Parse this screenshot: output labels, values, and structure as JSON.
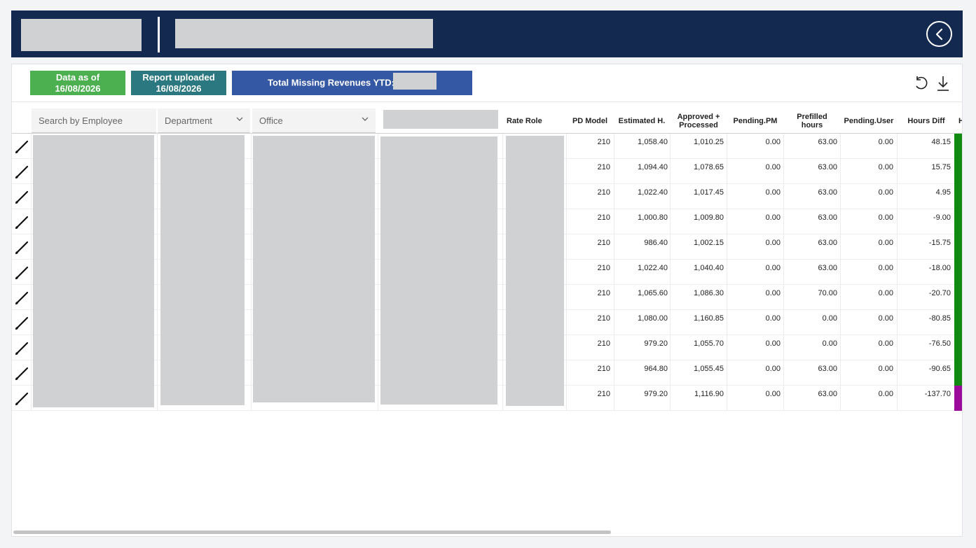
{
  "header": {
    "back_icon": "chevron-left-circle-icon"
  },
  "badges": {
    "data_as_of_label": "Data as of",
    "data_as_of_date": "16/08/2026",
    "report_uploaded_label": "Report uploaded",
    "report_uploaded_date": "16/08/2026",
    "total_missing_label": "Total Missing Revenues YTD:"
  },
  "toolbar": {
    "undo_icon": "undo-icon",
    "download_icon": "download-icon"
  },
  "filters": {
    "employee_placeholder": "Search by Employee",
    "department": "Department",
    "office": "Office"
  },
  "columns": {
    "rate_role": "Rate Role",
    "pd_model": "PD Model",
    "estimated": "Estimated H.",
    "approved_line1": "Approved +",
    "approved_line2": "Processed",
    "pending_pm": "Pending.PM",
    "prefilled_line1": "Prefilled",
    "prefilled_line2": "hours",
    "pending_user": "Pending.User",
    "hours_diff": "Hours Diff",
    "truncated": "H"
  },
  "colors": {
    "header_bg": "#13294f",
    "badge_green": "#4caf50",
    "badge_teal": "#2b7880",
    "badge_blue": "#3558a4",
    "status_green": "#108a10",
    "status_purple": "#9b0a9b"
  },
  "rows": [
    {
      "pd_model": "210",
      "estimated": "1,058.40",
      "approved": "1,010.25",
      "pending_pm": "0.00",
      "prefilled": "63.00",
      "pending_user": "0.00",
      "hours_diff": "48.15",
      "status_color": "#108a10"
    },
    {
      "pd_model": "210",
      "estimated": "1,094.40",
      "approved": "1,078.65",
      "pending_pm": "0.00",
      "prefilled": "63.00",
      "pending_user": "0.00",
      "hours_diff": "15.75",
      "status_color": "#108a10"
    },
    {
      "pd_model": "210",
      "estimated": "1,022.40",
      "approved": "1,017.45",
      "pending_pm": "0.00",
      "prefilled": "63.00",
      "pending_user": "0.00",
      "hours_diff": "4.95",
      "status_color": "#108a10"
    },
    {
      "pd_model": "210",
      "estimated": "1,000.80",
      "approved": "1,009.80",
      "pending_pm": "0.00",
      "prefilled": "63.00",
      "pending_user": "0.00",
      "hours_diff": "-9.00",
      "status_color": "#108a10"
    },
    {
      "pd_model": "210",
      "estimated": "986.40",
      "approved": "1,002.15",
      "pending_pm": "0.00",
      "prefilled": "63.00",
      "pending_user": "0.00",
      "hours_diff": "-15.75",
      "status_color": "#108a10"
    },
    {
      "pd_model": "210",
      "estimated": "1,022.40",
      "approved": "1,040.40",
      "pending_pm": "0.00",
      "prefilled": "63.00",
      "pending_user": "0.00",
      "hours_diff": "-18.00",
      "status_color": "#108a10"
    },
    {
      "pd_model": "210",
      "estimated": "1,065.60",
      "approved": "1,086.30",
      "pending_pm": "0.00",
      "prefilled": "70.00",
      "pending_user": "0.00",
      "hours_diff": "-20.70",
      "status_color": "#108a10"
    },
    {
      "pd_model": "210",
      "estimated": "1,080.00",
      "approved": "1,160.85",
      "pending_pm": "0.00",
      "prefilled": "0.00",
      "pending_user": "0.00",
      "hours_diff": "-80.85",
      "status_color": "#108a10"
    },
    {
      "pd_model": "210",
      "estimated": "979.20",
      "approved": "1,055.70",
      "pending_pm": "0.00",
      "prefilled": "0.00",
      "pending_user": "0.00",
      "hours_diff": "-76.50",
      "status_color": "#108a10"
    },
    {
      "pd_model": "210",
      "estimated": "964.80",
      "approved": "1,055.45",
      "pending_pm": "0.00",
      "prefilled": "63.00",
      "pending_user": "0.00",
      "hours_diff": "-90.65",
      "status_color": "#108a10"
    },
    {
      "pd_model": "210",
      "estimated": "979.20",
      "approved": "1,116.90",
      "pending_pm": "0.00",
      "prefilled": "63.00",
      "pending_user": "0.00",
      "hours_diff": "-137.70",
      "status_color": "#9b0a9b"
    }
  ]
}
